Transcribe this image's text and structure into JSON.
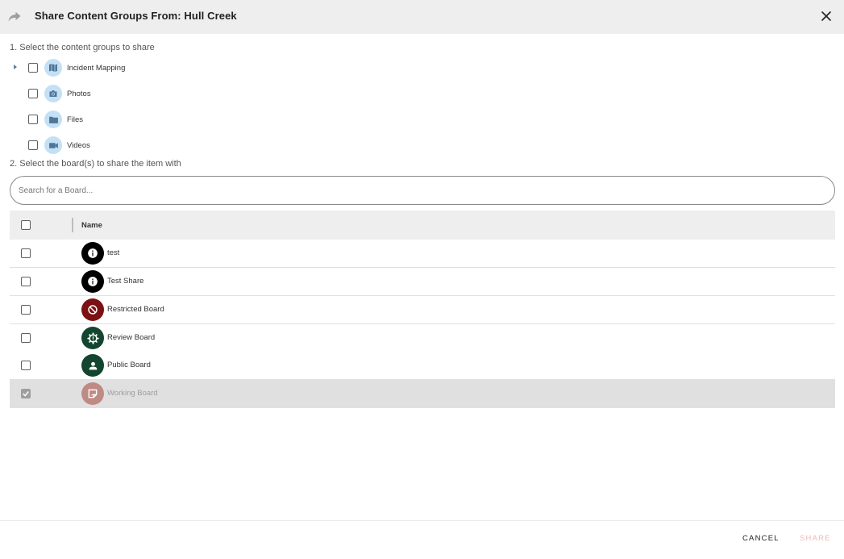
{
  "dialog": {
    "title": "Share Content Groups From: Hull Creek",
    "share_icon": "share-arrow-icon",
    "close_icon": "close-icon"
  },
  "step1": {
    "label": "1. Select the content groups to share",
    "groups": [
      {
        "label": "Incident Mapping",
        "icon": "map-icon",
        "expandable": true
      },
      {
        "label": "Photos",
        "icon": "camera-icon",
        "expandable": false
      },
      {
        "label": "Files",
        "icon": "folder-icon",
        "expandable": false
      },
      {
        "label": "Videos",
        "icon": "video-camera-icon",
        "expandable": false
      }
    ]
  },
  "step2": {
    "label": "2. Select the board(s) to share the item with",
    "search_placeholder": "Search for a Board...",
    "table": {
      "column_name": "Name",
      "rows": [
        {
          "name": "test",
          "icon": "info-icon",
          "color": "#000000",
          "checked": false
        },
        {
          "name": "Test Share",
          "icon": "info-icon",
          "color": "#000000",
          "checked": false
        },
        {
          "name": "Restricted Board",
          "icon": "block-icon",
          "color": "#7b1113",
          "checked": false
        },
        {
          "name": "Review Board",
          "icon": "gear-icon",
          "color": "#14452f",
          "checked": false
        },
        {
          "name": "Public Board",
          "icon": "person-icon",
          "color": "#14452f",
          "checked": false
        },
        {
          "name": "Working Board",
          "icon": "note-edit-icon",
          "color": "#c08a84",
          "checked": true
        }
      ]
    }
  },
  "footer": {
    "cancel_label": "CANCEL",
    "share_label": "SHARE"
  },
  "colors": {
    "header_bg": "#eeeeee",
    "group_icon_bg": "#c4e0f5",
    "group_icon_fg": "#4f7597",
    "share_disabled": "#f0b8b8"
  }
}
